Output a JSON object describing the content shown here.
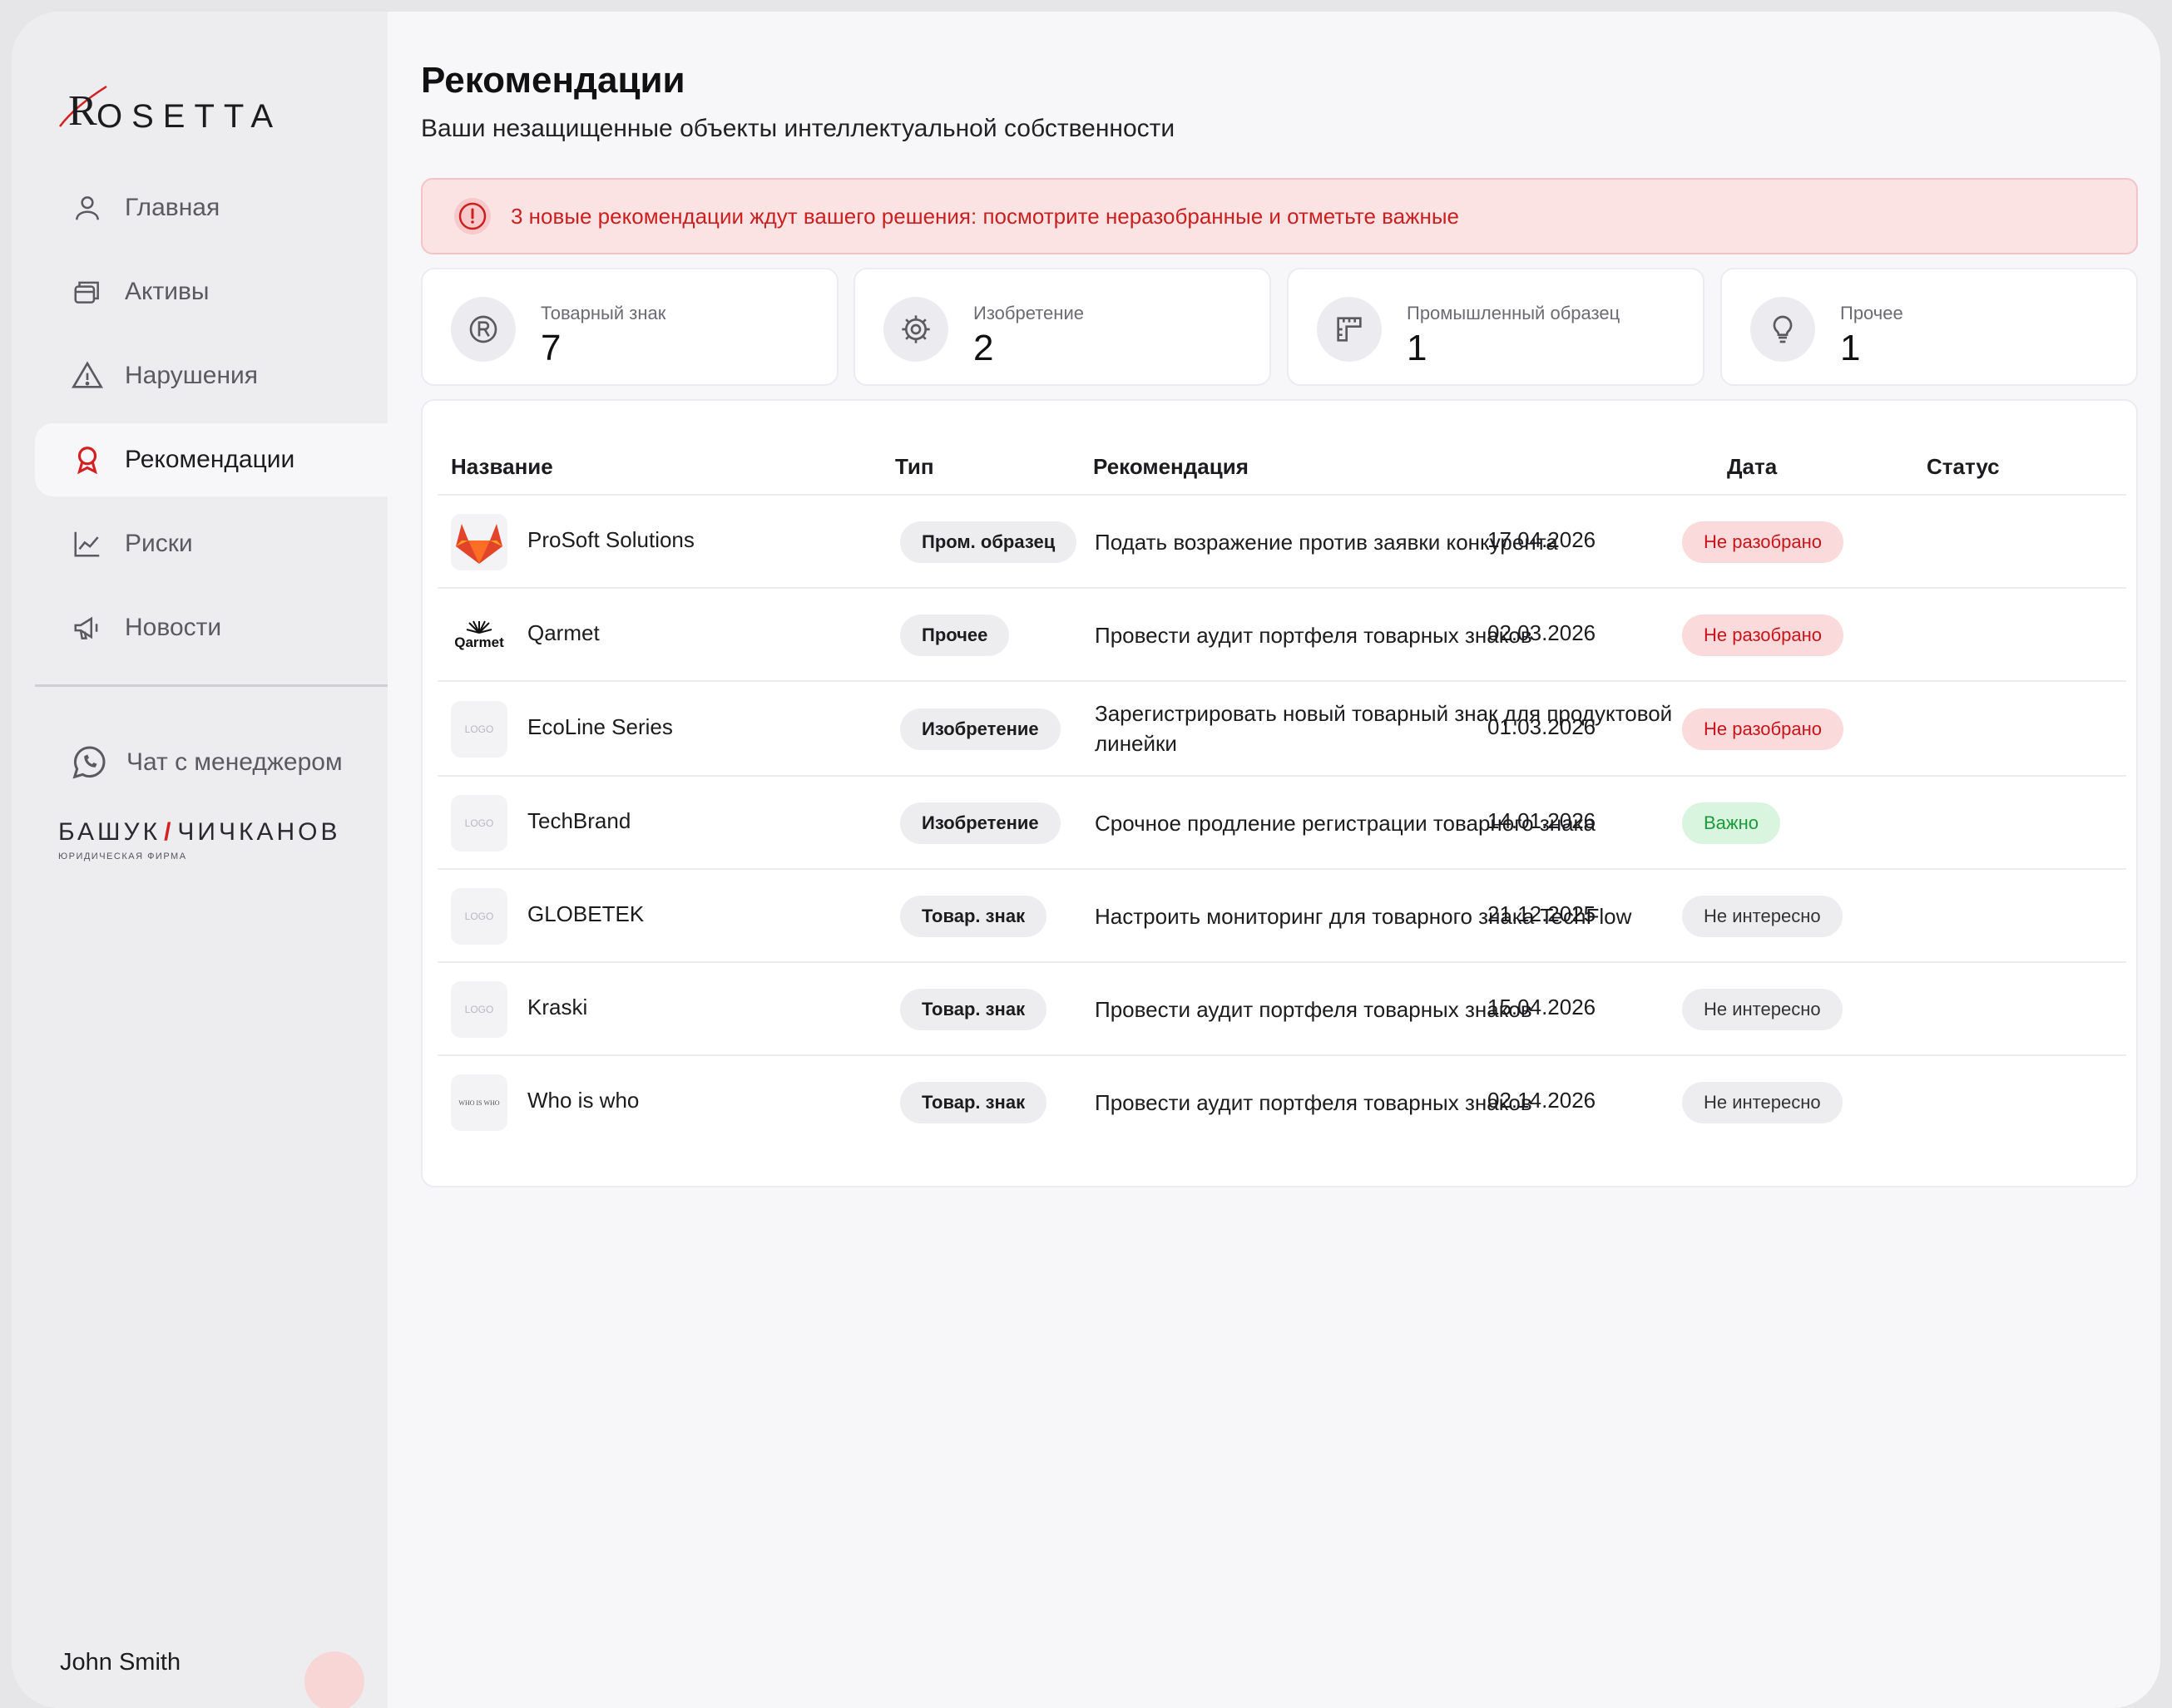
{
  "brand": {
    "name": "OSETTA",
    "initial": "R"
  },
  "sidebar": {
    "items": [
      {
        "label": "Главная",
        "icon": "user-icon"
      },
      {
        "label": "Активы",
        "icon": "assets-icon"
      },
      {
        "label": "Нарушения",
        "icon": "warning-icon"
      },
      {
        "label": "Рекомендации",
        "icon": "award-icon",
        "active": true
      },
      {
        "label": "Риски",
        "icon": "chart-icon"
      },
      {
        "label": "Новости",
        "icon": "megaphone-icon"
      }
    ],
    "chat_label": "Чат с менеджером",
    "partner": {
      "left": "БАШУК",
      "slash": "/",
      "right": "ЧИЧКАНОВ",
      "sub": "ЮРИДИЧЕСКАЯ ФИРМА"
    },
    "user_name": "John Smith"
  },
  "header": {
    "title": "Рекомендации",
    "subtitle": "Ваши незащищенные объекты интеллектуальной собственности"
  },
  "alert": {
    "text": "3 новые рекомендации ждут вашего решения: посмотрите неразобранные и отметьте важные",
    "color": "#cc1f1f"
  },
  "stats": [
    {
      "label": "Товарный знак",
      "value": "7",
      "icon": "registered-icon"
    },
    {
      "label": "Изобретение",
      "value": "2",
      "icon": "gear-icon"
    },
    {
      "label": "Промышленный образец",
      "value": "1",
      "icon": "ruler-icon"
    },
    {
      "label": "Прочее",
      "value": "1",
      "icon": "lightbulb-icon"
    }
  ],
  "table": {
    "columns": [
      "Название",
      "Тип",
      "Рекомендация",
      "Дата",
      "Статус"
    ],
    "rows": [
      {
        "name": "ProSoft Solutions",
        "type": "Пром. образец",
        "recommendation": "Подать возражение против заявки конкурента",
        "date": "17.04.2026",
        "status": "Не разобрано",
        "logo": "gitlab-fox-logo"
      },
      {
        "name": "Qarmet",
        "type": "Прочее",
        "recommendation": "Провести аудит портфеля товарных знаков",
        "date": "02.03.2026",
        "status": "Не разобрано",
        "logo": "qarmet-logo",
        "logo_text": "Qarmet"
      },
      {
        "name": "EcoLine Series",
        "type": "Изобретение",
        "recommendation": "Зарегистрировать новый товарный знак для продуктовой линейки",
        "date": "01.03.2026",
        "status": "Не разобрано",
        "logo": "placeholder-logo",
        "logo_text": "LOGO"
      },
      {
        "name": "TechBrand",
        "type": "Изобретение",
        "recommendation": "Срочное продление регистрации товарного знака",
        "date": "14.01.2026",
        "status": "Важно",
        "logo": "placeholder-logo",
        "logo_text": "LOGO"
      },
      {
        "name": "GLOBETEK",
        "type": "Товар. знак",
        "recommendation": "Настроить мониторинг для товарного знака TechFlow",
        "date": "21.12.2025",
        "status": "Не интересно",
        "logo": "placeholder-logo",
        "logo_text": "LOGO"
      },
      {
        "name": "Kraski",
        "type": "Товар. знак",
        "recommendation": "Провести аудит портфеля товарных знаков",
        "date": "15.04.2026",
        "status": "Не интересно",
        "logo": "placeholder-logo",
        "logo_text": "LOGO"
      },
      {
        "name": "Who is who",
        "type": "Товар. знак",
        "recommendation": "Провести аудит портфеля товарных знаков",
        "date": "02.14.2026",
        "status": "Не интересно",
        "logo": "whoiswho-logo",
        "logo_text": "WHO IS WHO"
      }
    ]
  },
  "colors": {
    "accent": "#d32020",
    "new": "#c8141a",
    "important": "#1a9a3a"
  }
}
